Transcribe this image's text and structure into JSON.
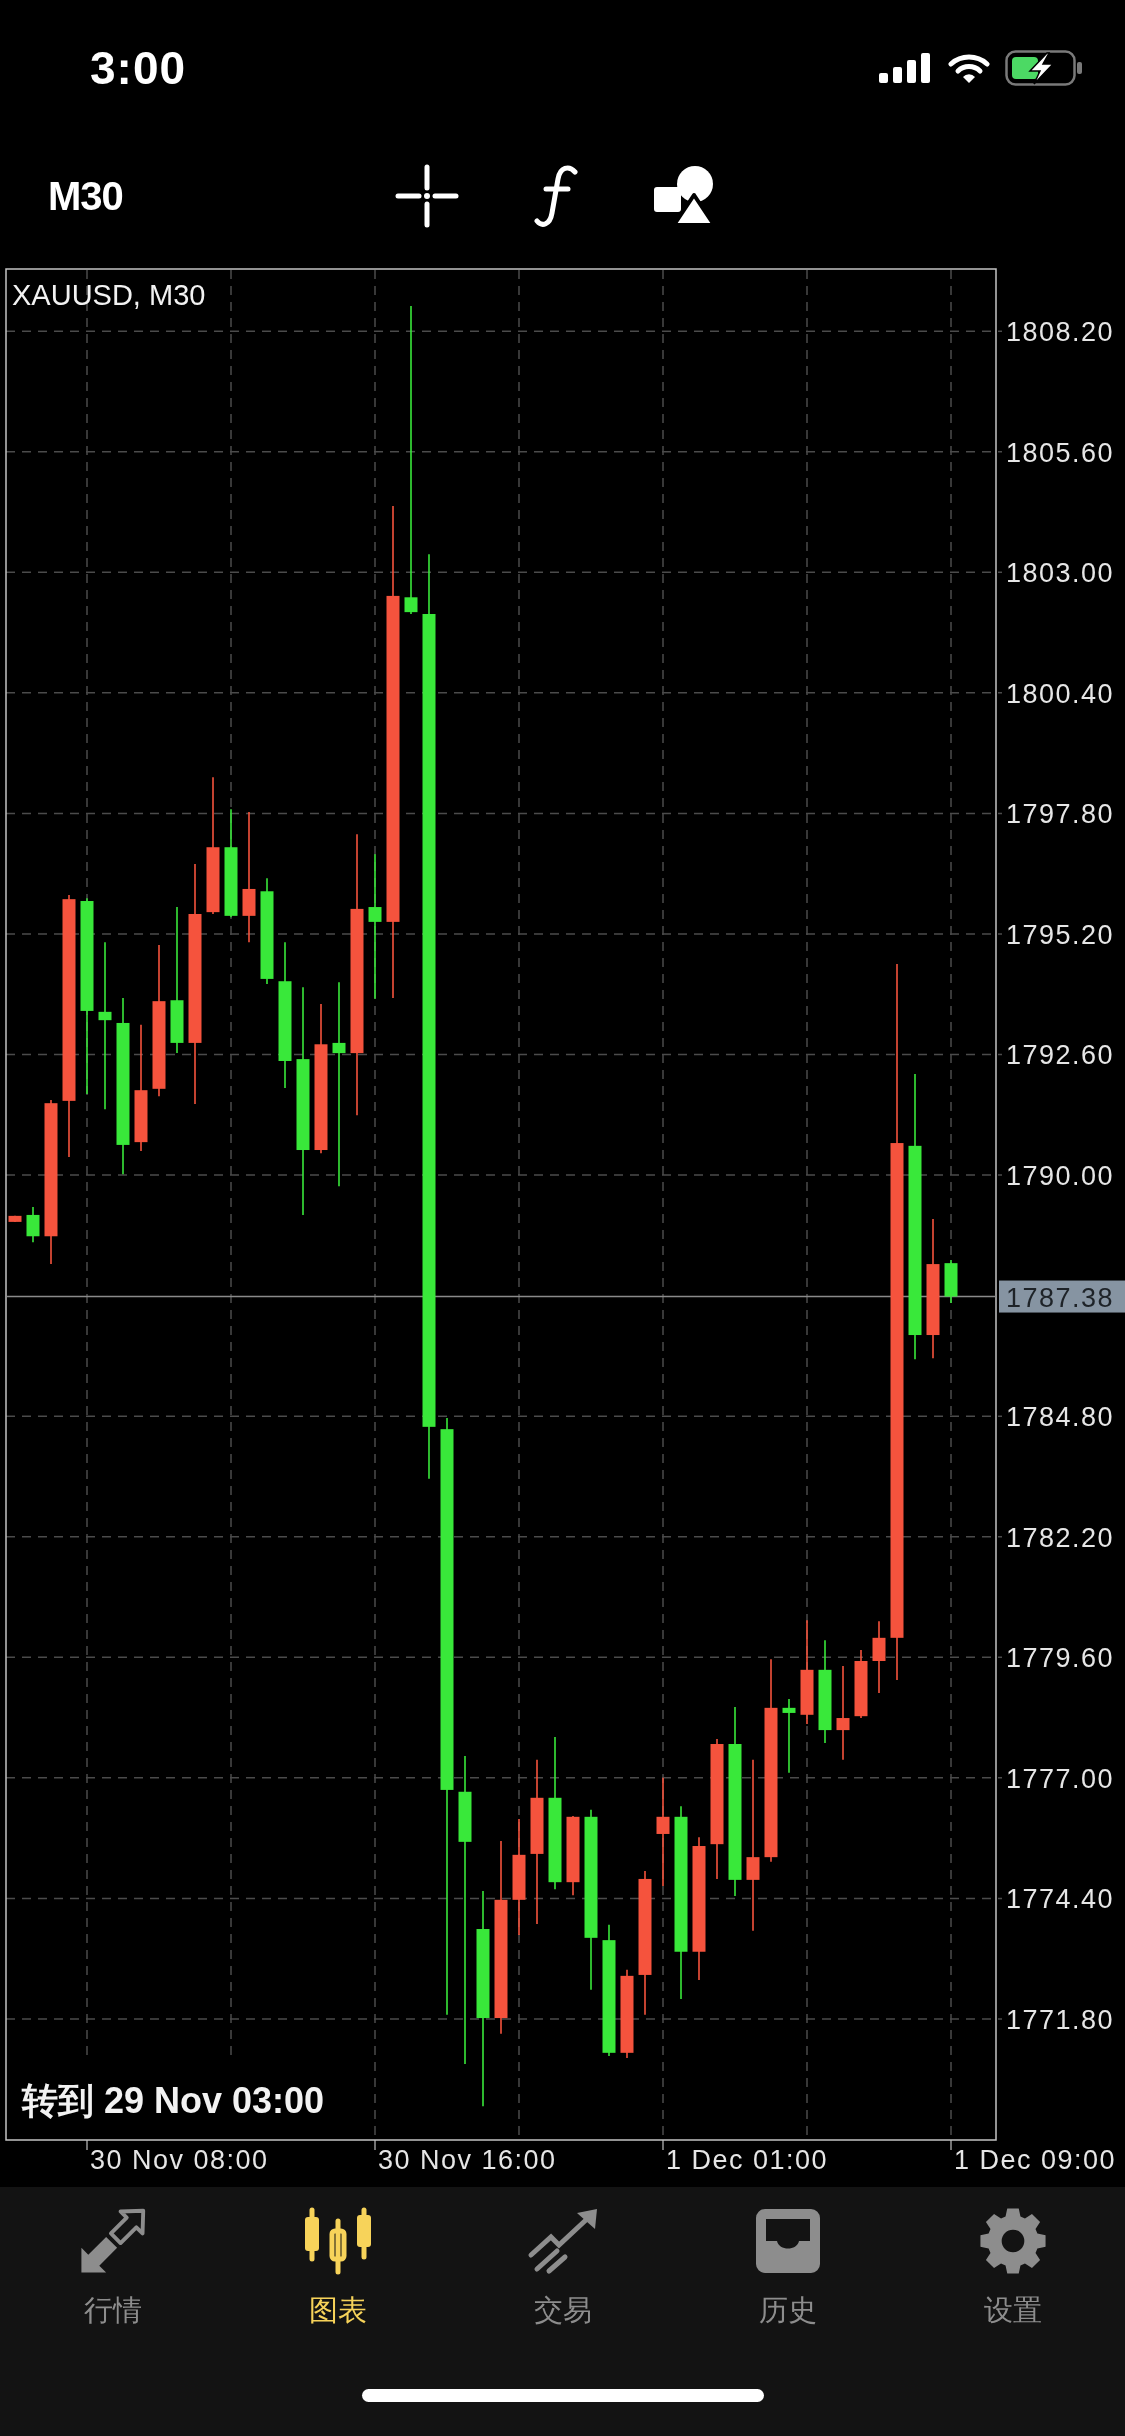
{
  "status_bar": {
    "time": "3:00"
  },
  "toolbar": {
    "timeframe": "M30"
  },
  "chart": {
    "goto_label": "转到 29 Nov 03:00",
    "time_labels": [
      "30 Nov 08:00",
      "30 Nov 16:00",
      "1 Dec 01:00",
      "1 Dec 09:00"
    ],
    "chart_data": {
      "type": "candlestick",
      "title": "XAUUSD, M30",
      "grid": true,
      "categories": [
        null,
        null,
        null,
        null,
        null,
        null,
        null,
        null,
        null,
        null,
        null,
        null,
        null,
        null,
        null,
        null,
        null,
        null,
        null,
        null,
        null,
        null,
        null,
        null,
        null,
        null,
        null,
        null,
        null,
        null,
        null,
        null,
        null,
        null,
        null,
        null,
        null,
        null,
        null,
        null,
        null,
        null,
        null,
        null,
        null,
        null,
        null,
        null,
        null,
        null,
        null,
        null,
        null,
        null,
        null
      ],
      "ohlc": [
        [
          1788.99,
          1789.12,
          1788.99,
          1789.12
        ],
        [
          1789.14,
          1789.31,
          1788.55,
          1788.68
        ],
        [
          1788.68,
          1791.62,
          1788.08,
          1791.55
        ],
        [
          1791.6,
          1796.04,
          1790.39,
          1795.95
        ],
        [
          1795.91,
          1795.97,
          1791.75,
          1793.54
        ],
        [
          1793.52,
          1795.02,
          1791.42,
          1793.34
        ],
        [
          1793.28,
          1793.82,
          1790.02,
          1790.65
        ],
        [
          1790.71,
          1793.24,
          1790.52,
          1791.83
        ],
        [
          1791.86,
          1794.96,
          1791.7,
          1793.75
        ],
        [
          1793.77,
          1795.78,
          1792.63,
          1792.85
        ],
        [
          1792.85,
          1796.71,
          1791.53,
          1795.63
        ],
        [
          1795.67,
          1798.58,
          1795.63,
          1797.07
        ],
        [
          1797.07,
          1797.89,
          1795.56,
          1795.59
        ],
        [
          1795.59,
          1797.83,
          1795.02,
          1796.17
        ],
        [
          1796.12,
          1796.4,
          1794.12,
          1794.23
        ],
        [
          1794.18,
          1795.02,
          1791.88,
          1792.46
        ],
        [
          1792.5,
          1794.05,
          1789.14,
          1790.54
        ],
        [
          1790.54,
          1793.69,
          1790.47,
          1792.82
        ],
        [
          1792.85,
          1794.16,
          1789.76,
          1792.63
        ],
        [
          1792.63,
          1797.35,
          1791.29,
          1795.74
        ],
        [
          1795.78,
          1796.92,
          1793.8,
          1795.46
        ],
        [
          1795.46,
          1804.43,
          1793.82,
          1802.49
        ],
        [
          1802.46,
          1808.74,
          1802.1,
          1802.14
        ],
        [
          1802.1,
          1803.39,
          1783.45,
          1784.57
        ],
        [
          1784.52,
          1784.76,
          1771.89,
          1776.74
        ],
        [
          1776.7,
          1777.47,
          1770.83,
          1775.62
        ],
        [
          1773.74,
          1774.56,
          1769.92,
          1771.82
        ],
        [
          1771.82,
          1775.64,
          1771.48,
          1774.37
        ],
        [
          1774.37,
          1776.11,
          1773.61,
          1775.34
        ],
        [
          1775.36,
          1777.39,
          1773.85,
          1776.57
        ],
        [
          1776.57,
          1777.88,
          1774.6,
          1774.75
        ],
        [
          1774.75,
          1776.18,
          1774.47,
          1776.16
        ],
        [
          1776.16,
          1776.31,
          1772.43,
          1773.55
        ],
        [
          1773.5,
          1773.83,
          1771.0,
          1771.07
        ],
        [
          1771.07,
          1772.86,
          1770.96,
          1772.73
        ],
        [
          1772.75,
          1774.99,
          1771.89,
          1774.82
        ],
        [
          1775.79,
          1777.0,
          1774.67,
          1776.16
        ],
        [
          1776.16,
          1776.39,
          1772.23,
          1773.25
        ],
        [
          1773.25,
          1775.72,
          1772.64,
          1775.53
        ],
        [
          1775.57,
          1777.84,
          1774.82,
          1777.73
        ],
        [
          1777.73,
          1778.53,
          1774.45,
          1774.8
        ],
        [
          1774.8,
          1777.39,
          1773.7,
          1775.29
        ],
        [
          1775.29,
          1779.56,
          1775.19,
          1778.51
        ],
        [
          1778.51,
          1778.7,
          1777.11,
          1778.4
        ],
        [
          1778.36,
          1780.4,
          1778.16,
          1779.33
        ],
        [
          1779.33,
          1779.97,
          1777.75,
          1778.03
        ],
        [
          1778.03,
          1779.41,
          1777.39,
          1778.29
        ],
        [
          1778.33,
          1779.76,
          1778.29,
          1779.52
        ],
        [
          1779.52,
          1780.38,
          1778.83,
          1780.02
        ],
        [
          1780.02,
          1794.55,
          1779.11,
          1790.69
        ],
        [
          1790.63,
          1792.18,
          1786.03,
          1786.55
        ],
        [
          1786.55,
          1789.05,
          1786.05,
          1788.08
        ],
        [
          1788.1,
          1788.17,
          1787.24,
          1787.38
        ],
        null,
        null
      ],
      "ylim": [
        1769.19,
        1809.54
      ],
      "yticks": [
        {
          "value": 1808.2,
          "label": "1808.20"
        },
        {
          "value": 1805.6,
          "label": "1805.60"
        },
        {
          "value": 1803.0,
          "label": "1803.00"
        },
        {
          "value": 1800.4,
          "label": "1800.40"
        },
        {
          "value": 1797.8,
          "label": "1797.80"
        },
        {
          "value": 1795.2,
          "label": "1795.20"
        },
        {
          "value": 1792.6,
          "label": "1792.60"
        },
        {
          "value": 1790.0,
          "label": "1790.00"
        },
        {
          "value": 1784.8,
          "label": "1784.80"
        },
        {
          "value": 1782.2,
          "label": "1782.20"
        },
        {
          "value": 1779.6,
          "label": "1779.60"
        },
        {
          "value": 1777.0,
          "label": "1777.00"
        },
        {
          "value": 1774.4,
          "label": "1774.40"
        },
        {
          "value": 1771.8,
          "label": "1771.80"
        }
      ],
      "ref_lines": [
        {
          "axis": "y",
          "value": 1787.38,
          "label": "1787.38"
        }
      ]
    }
  },
  "tabs": [
    {
      "kind": "quotes",
      "label": "行情",
      "selected": false
    },
    {
      "kind": "chart",
      "label": "图表",
      "selected": true
    },
    {
      "kind": "trade",
      "label": "交易",
      "selected": false
    },
    {
      "kind": "history",
      "label": "历史",
      "selected": false
    },
    {
      "kind": "settings",
      "label": "设置",
      "selected": false
    }
  ]
}
